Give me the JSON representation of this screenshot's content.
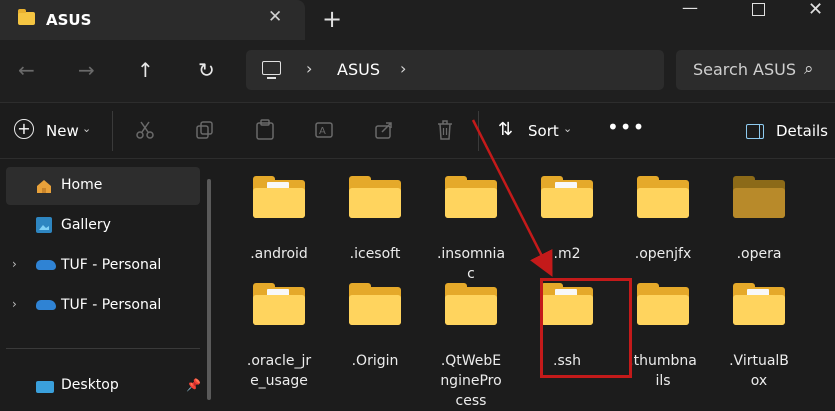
{
  "window": {
    "tab_title": "ASUS",
    "new_tab": "+",
    "minimize": "—",
    "close": "✕"
  },
  "nav": {
    "back": "←",
    "forward": "→",
    "up": "↑",
    "refresh": "↻",
    "address": "ASUS",
    "chevron": "›",
    "search_placeholder": "Search ASUS",
    "search_icon": "⌕"
  },
  "commands": {
    "new_label": "New",
    "sort_label": "Sort",
    "more": "•••",
    "details_label": "Details",
    "icons": [
      "cut-icon",
      "copy-icon",
      "paste-icon",
      "rename-icon",
      "share-icon",
      "delete-icon",
      "sort-icon"
    ]
  },
  "sidebar": {
    "items": [
      {
        "label": "Home",
        "icon": "home-icon",
        "selected": true
      },
      {
        "label": "Gallery",
        "icon": "gallery-icon"
      },
      {
        "label": "TUF - Personal",
        "icon": "onedrive-icon"
      },
      {
        "label": "TUF - Personal",
        "icon": "onedrive-icon"
      },
      {
        "label": "Desktop",
        "icon": "desktop-icon",
        "pinned": true
      }
    ]
  },
  "files": [
    {
      "name": ".android",
      "icon": "folder-with-file-icon"
    },
    {
      "name": ".icesoft",
      "icon": "folder-icon"
    },
    {
      "name": ".insomnia c",
      "icon": "folder-icon"
    },
    {
      "name": ".m2",
      "icon": "folder-with-file-icon"
    },
    {
      "name": ".openjfx",
      "icon": "folder-icon"
    },
    {
      "name": ".opera",
      "icon": "folder-icon-dim"
    },
    {
      "name": ".oracle_jr e_usage",
      "icon": "folder-with-file-icon"
    },
    {
      "name": ".Origin",
      "icon": "folder-icon"
    },
    {
      "name": ".QtWebE nginePro cess",
      "icon": "folder-icon"
    },
    {
      "name": ".ssh",
      "icon": "folder-with-file-icon"
    },
    {
      "name": ".thumbna ils",
      "icon": "folder-icon"
    },
    {
      "name": ".VirtualB ox",
      "icon": "folder-with-file-icon"
    }
  ],
  "file_lines": [
    [
      ".android"
    ],
    [
      ".icesoft"
    ],
    [
      ".insomnia",
      "c"
    ],
    [
      ".m2"
    ],
    [
      ".openjfx"
    ],
    [
      ".opera"
    ],
    [
      ".oracle_jr",
      "e_usage"
    ],
    [
      ".Origin"
    ],
    [
      ".QtWebE",
      "nginePro",
      "cess"
    ],
    [
      ".ssh"
    ],
    [
      ".thumbna",
      "ils"
    ],
    [
      ".VirtualB",
      "ox"
    ]
  ],
  "colors": {
    "highlight": "#c41a1a",
    "accent": "#8ecbf0",
    "folder": "#ffd45e"
  }
}
